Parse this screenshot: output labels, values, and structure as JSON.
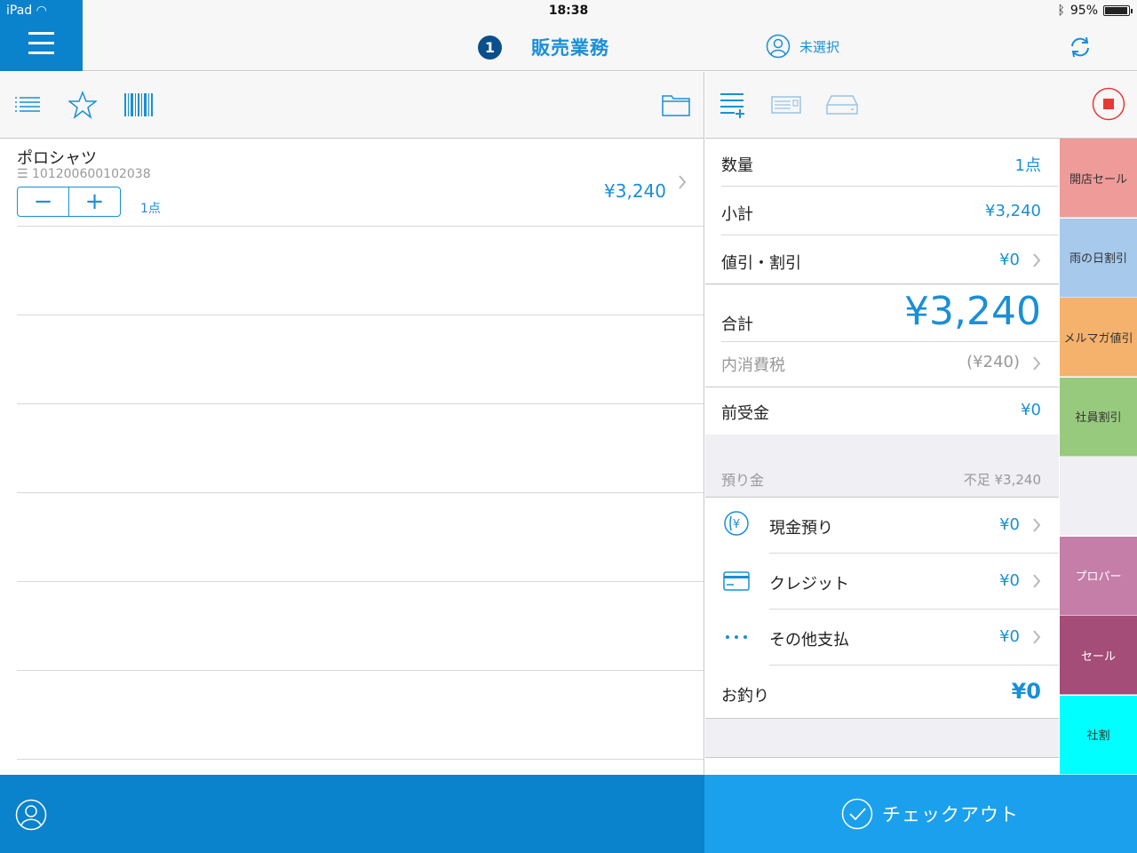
{
  "status_bar": {
    "device": "iPad",
    "time": "18:38",
    "battery": "95%",
    "battery_level": 0.95
  },
  "header": {
    "menu_icon": "hamburger-icon",
    "register_number": "1",
    "title": "販売業務",
    "customer_label": "未選択",
    "sync_icon": "refresh-icon"
  },
  "left_toolbar": {
    "icons": [
      "list-icon",
      "star-icon",
      "barcode-icon",
      "folder-icon"
    ]
  },
  "right_toolbar": {
    "icons": [
      "add-list-icon",
      "card-reader-icon",
      "cash-drawer-icon",
      "stop-icon"
    ]
  },
  "item": {
    "name": "ポロシャツ",
    "code": "101200600102038",
    "qty_label": "1点",
    "price": "¥3,240"
  },
  "summary": {
    "quantity": {
      "label": "数量",
      "value": "1点"
    },
    "subtotal": {
      "label": "小計",
      "value": "¥3,240"
    },
    "discount": {
      "label": "値引・割引",
      "value": "¥0"
    },
    "total": {
      "label": "合計",
      "value": "¥3,240"
    },
    "tax": {
      "label": "内消費税",
      "value": "(¥240)"
    },
    "advance": {
      "label": "前受金",
      "value": "¥0"
    },
    "deposit_header": {
      "label": "預り金",
      "shortage": "不足 ¥3,240"
    },
    "cash": {
      "label": "現金預り",
      "value": "¥0"
    },
    "credit": {
      "label": "クレジット",
      "value": "¥0"
    },
    "other": {
      "label": "その他支払",
      "value": "¥0"
    },
    "change": {
      "label": "お釣り",
      "value": "¥0"
    }
  },
  "discount_buttons": [
    {
      "label": "開店セール",
      "color": "#ee9b99"
    },
    {
      "label": "雨の日割引",
      "color": "#a6c9ec"
    },
    {
      "label": "メルマガ値引",
      "color": "#f4b26d"
    },
    {
      "label": "社員割引",
      "color": "#98ca7e"
    },
    {
      "label": "",
      "color": "#efeff4"
    },
    {
      "label": "プロパー",
      "color": "#c47ea8"
    },
    {
      "label": "セール",
      "color": "#a34d78"
    },
    {
      "label": "社割",
      "color": "#00ffff"
    }
  ],
  "footer": {
    "customer_icon": "person-icon",
    "checkout_label": "チェックアウト"
  },
  "colors": {
    "accent": "#1a8fd6",
    "header_blue": "#0a82cc",
    "checkout_blue": "#1aa0ec",
    "stop_red": "#e53935"
  }
}
